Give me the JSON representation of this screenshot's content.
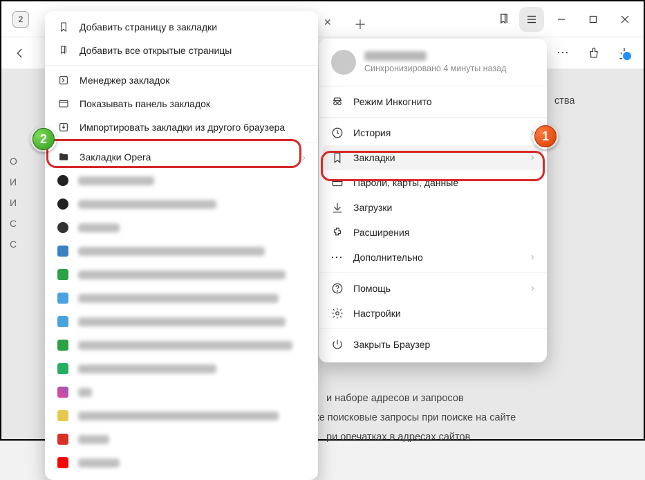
{
  "window": {
    "tab_counter": "2"
  },
  "addrbar": {
    "more": "⋯"
  },
  "main_menu": {
    "sync_status": "Синхронизировано 4 минуты назад",
    "incognito": "Режим Инкогнито",
    "history": "История",
    "bookmarks": "Закладки",
    "passwords": "Пароли, карты, данные",
    "downloads": "Загрузки",
    "extensions": "Расширения",
    "more": "Дополнительно",
    "help": "Помощь",
    "settings": "Настройки",
    "close": "Закрыть Браузер"
  },
  "sub_menu": {
    "add_page": "Добавить страницу в закладки",
    "add_all": "Добавить все открытые страницы",
    "manager": "Менеджер закладок",
    "show_bar": "Показывать панель закладок",
    "import": "Импортировать закладки из другого браузера",
    "folder_opera": "Закладки Opera"
  },
  "page_bg": {
    "line1": "ства",
    "line2": "и наборе адресов и запросов",
    "line3": "же поисковые запросы при поиске на сайте",
    "line4": "ри опечатках в адресах сайтов"
  },
  "callouts": {
    "one": "1",
    "two": "2"
  }
}
